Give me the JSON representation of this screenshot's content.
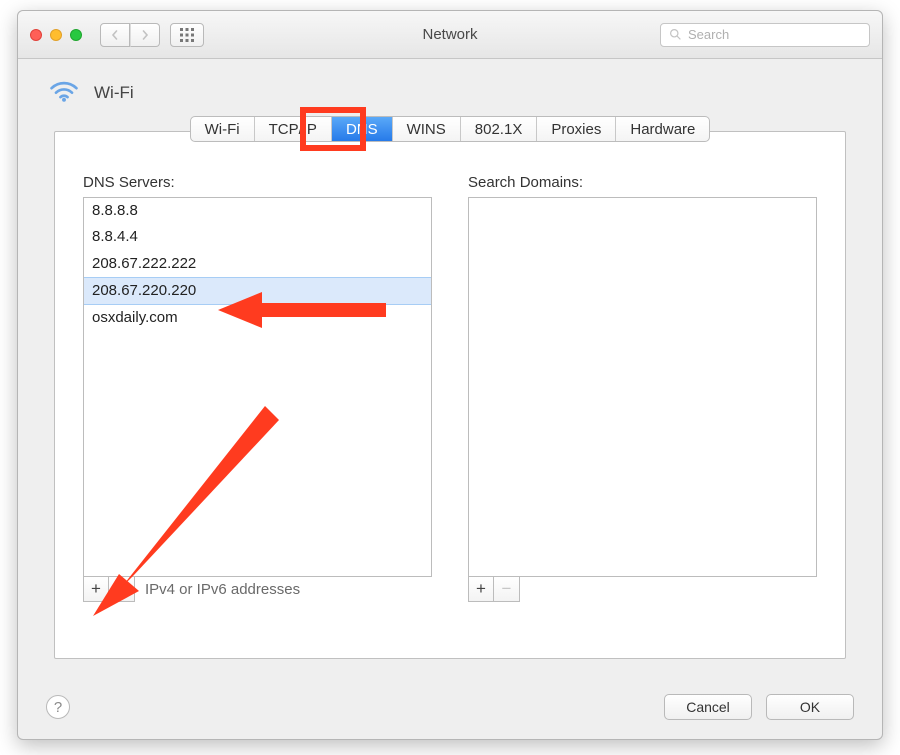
{
  "window": {
    "title": "Network"
  },
  "search": {
    "placeholder": "Search"
  },
  "header": {
    "connection_name": "Wi-Fi"
  },
  "tabs": [
    {
      "label": "Wi-Fi",
      "active": false
    },
    {
      "label": "TCP/IP",
      "active": false
    },
    {
      "label": "DNS",
      "active": true
    },
    {
      "label": "WINS",
      "active": false
    },
    {
      "label": "802.1X",
      "active": false
    },
    {
      "label": "Proxies",
      "active": false
    },
    {
      "label": "Hardware",
      "active": false
    }
  ],
  "dns": {
    "label": "DNS Servers:",
    "servers": [
      {
        "value": "8.8.8.8",
        "selected": false
      },
      {
        "value": "8.8.4.4",
        "selected": false
      },
      {
        "value": "208.67.222.222",
        "selected": false
      },
      {
        "value": "208.67.220.220",
        "selected": true
      },
      {
        "value": "osxdaily.com",
        "selected": false
      }
    ],
    "footer_label": "IPv4 or IPv6 addresses"
  },
  "search_domains": {
    "label": "Search Domains:",
    "items": []
  },
  "buttons": {
    "cancel": "Cancel",
    "ok": "OK",
    "plus": "+",
    "minus": "−",
    "help": "?"
  },
  "icons": {
    "grid": "⊞"
  },
  "annotations": {
    "highlight_tab": "DNS",
    "arrow_to_row_index": 3,
    "arrow_to_plus_button": true
  }
}
